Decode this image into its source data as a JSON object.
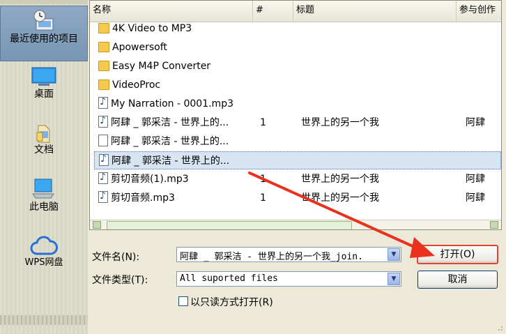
{
  "places": [
    {
      "label": "最近使用的项目",
      "icon": "recent-items-icon"
    },
    {
      "label": "桌面",
      "icon": "desktop-icon"
    },
    {
      "label": "文档",
      "icon": "documents-icon"
    },
    {
      "label": "此电脑",
      "icon": "this-pc-icon"
    },
    {
      "label": "WPS网盘",
      "icon": "wps-cloud-icon"
    }
  ],
  "columns": {
    "name": "名称",
    "num": "#",
    "title": "标题",
    "artist": "参与创作"
  },
  "rows": [
    {
      "type": "folder",
      "name": "4K Video to MP3",
      "num": "",
      "title": "",
      "artist": ""
    },
    {
      "type": "folder",
      "name": "Apowersoft",
      "num": "",
      "title": "",
      "artist": ""
    },
    {
      "type": "folder",
      "name": "Easy M4P Converter",
      "num": "",
      "title": "",
      "artist": ""
    },
    {
      "type": "folder",
      "name": "VideoProc",
      "num": "",
      "title": "",
      "artist": ""
    },
    {
      "type": "audio",
      "name": "My Narration - 0001.mp3",
      "num": "",
      "title": "",
      "artist": ""
    },
    {
      "type": "audio",
      "name": "阿肆 _ 郭采洁 - 世界上的...",
      "num": "1",
      "title": "世界上的另一个我",
      "artist": "阿肆"
    },
    {
      "type": "doc",
      "name": "阿肆 _ 郭采洁 - 世界上的...",
      "num": "",
      "title": "",
      "artist": ""
    },
    {
      "type": "audio",
      "name": "阿肆 _ 郭采洁 - 世界上的...",
      "num": "",
      "title": "",
      "artist": ""
    },
    {
      "type": "audio",
      "name": "剪切音频(1).mp3",
      "num": "1",
      "title": "世界上的另一个我",
      "artist": "阿肆"
    },
    {
      "type": "audio",
      "name": "剪切音频.mp3",
      "num": "1",
      "title": "世界上的另一个我",
      "artist": "阿肆"
    }
  ],
  "selected_row": 7,
  "filename": {
    "label": "文件名(N):",
    "value": "阿肆 _ 郭采洁 - 世界上的另一个我_join."
  },
  "filetype": {
    "label": "文件类型(T):",
    "value": "All suported files"
  },
  "readonly_label": "以只读方式打开(R)",
  "buttons": {
    "open": "打开(O)",
    "cancel": "取消"
  },
  "colors": {
    "annotation_arrow": "#e8321e",
    "selection": "#d7e4f2"
  }
}
